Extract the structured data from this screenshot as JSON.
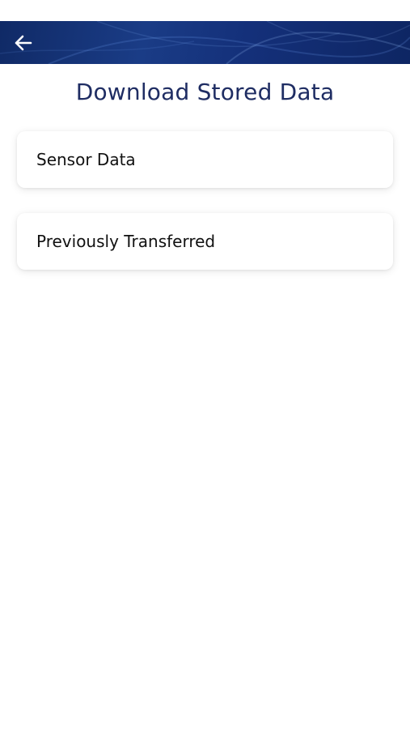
{
  "header": {
    "back_icon": "arrow-left-icon"
  },
  "page": {
    "title": "Download Stored Data"
  },
  "menu": {
    "items": [
      {
        "label": "Sensor Data"
      },
      {
        "label": "Previously Transferred"
      }
    ]
  },
  "colors": {
    "header_background": "#14307a",
    "title_color": "#1f2d63",
    "card_background": "#ffffff",
    "page_background": "#ffffff"
  }
}
